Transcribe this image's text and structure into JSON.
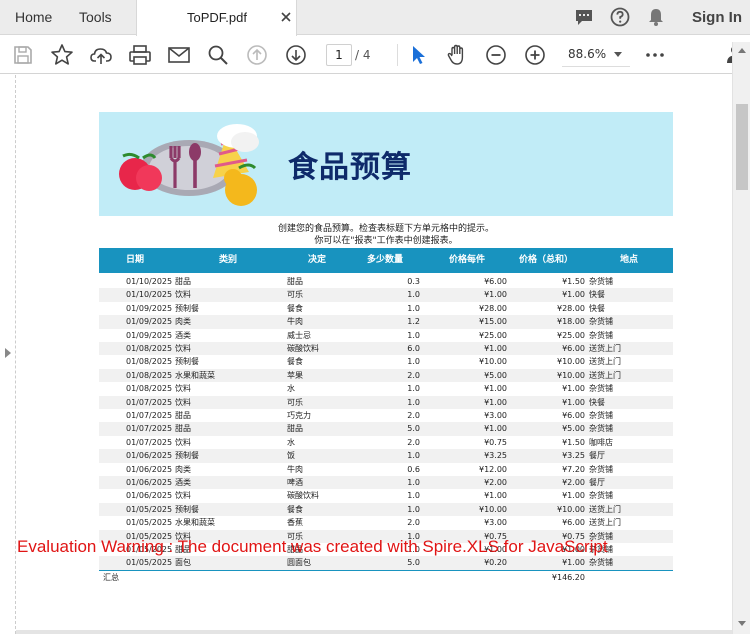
{
  "tabs": {
    "home": "Home",
    "tools": "Tools",
    "document": "ToPDF.pdf"
  },
  "header": {
    "sign_in": "Sign In"
  },
  "toolbar": {
    "current_page": "1",
    "total_pages": "/ 4",
    "zoom": "88.6%"
  },
  "document": {
    "title": "食品预算",
    "instruction_1": "创建您的食品预算。检查表标题下方单元格中的提示。",
    "instruction_2": "你可以在\"报表\"工作表中创建报表。",
    "columns": [
      "日期",
      "类别",
      "决定",
      "多少数量",
      "价格每件",
      "价格（总和）",
      "地点"
    ],
    "rows": [
      [
        "01/10/2025",
        "甜品",
        "甜品",
        "0.3",
        "¥6.00",
        "¥1.50",
        "杂货铺"
      ],
      [
        "01/10/2025",
        "饮料",
        "可乐",
        "1.0",
        "¥1.00",
        "¥1.00",
        "快餐"
      ],
      [
        "01/09/2025",
        "预制餐",
        "餐食",
        "1.0",
        "¥28.00",
        "¥28.00",
        "快餐"
      ],
      [
        "01/09/2025",
        "肉类",
        "牛肉",
        "1.2",
        "¥15.00",
        "¥18.00",
        "杂货铺"
      ],
      [
        "01/09/2025",
        "酒类",
        "威士忌",
        "1.0",
        "¥25.00",
        "¥25.00",
        "杂货铺"
      ],
      [
        "01/08/2025",
        "饮料",
        "碳酸饮料",
        "6.0",
        "¥1.00",
        "¥6.00",
        "送货上门"
      ],
      [
        "01/08/2025",
        "预制餐",
        "餐食",
        "1.0",
        "¥10.00",
        "¥10.00",
        "送货上门"
      ],
      [
        "01/08/2025",
        "水果和蔬菜",
        "苹果",
        "2.0",
        "¥5.00",
        "¥10.00",
        "送货上门"
      ],
      [
        "01/08/2025",
        "饮料",
        "水",
        "1.0",
        "¥1.00",
        "¥1.00",
        "杂货铺"
      ],
      [
        "01/07/2025",
        "饮料",
        "可乐",
        "1.0",
        "¥1.00",
        "¥1.00",
        "快餐"
      ],
      [
        "01/07/2025",
        "甜品",
        "巧克力",
        "2.0",
        "¥3.00",
        "¥6.00",
        "杂货铺"
      ],
      [
        "01/07/2025",
        "甜品",
        "甜品",
        "5.0",
        "¥1.00",
        "¥5.00",
        "杂货铺"
      ],
      [
        "01/07/2025",
        "饮料",
        "水",
        "2.0",
        "¥0.75",
        "¥1.50",
        "咖啡店"
      ],
      [
        "01/06/2025",
        "预制餐",
        "饭",
        "1.0",
        "¥3.25",
        "¥3.25",
        "餐厅"
      ],
      [
        "01/06/2025",
        "肉类",
        "牛肉",
        "0.6",
        "¥12.00",
        "¥7.20",
        "杂货铺"
      ],
      [
        "01/06/2025",
        "酒类",
        "啤酒",
        "1.0",
        "¥2.00",
        "¥2.00",
        "餐厅"
      ],
      [
        "01/06/2025",
        "饮料",
        "碳酸饮料",
        "1.0",
        "¥1.00",
        "¥1.00",
        "杂货铺"
      ],
      [
        "01/05/2025",
        "预制餐",
        "餐食",
        "1.0",
        "¥10.00",
        "¥10.00",
        "送货上门"
      ],
      [
        "01/05/2025",
        "水果和蔬菜",
        "香蕉",
        "2.0",
        "¥3.00",
        "¥6.00",
        "送货上门"
      ],
      [
        "01/05/2025",
        "饮料",
        "可乐",
        "1.0",
        "¥0.75",
        "¥0.75",
        "杂货铺"
      ],
      [
        "01/05/2025",
        "甜品",
        "甜品",
        "1.0",
        "¥1.00",
        "¥1.00",
        "杂货铺"
      ],
      [
        "01/05/2025",
        "面包",
        "圆面包",
        "5.0",
        "¥0.20",
        "¥1.00",
        "杂货铺"
      ]
    ],
    "total_label": "汇总",
    "total_value": "¥146.20",
    "watermark": "Evaluation Warning : The document was created with  Spire.XLS for JavaScript"
  },
  "icons": {
    "top": [
      "comment-icon",
      "help-icon",
      "bell-icon"
    ],
    "toolbar": [
      "save-icon",
      "star-icon",
      "cloud-upload-icon",
      "print-icon",
      "mail-icon",
      "search-icon",
      "page-up-icon",
      "page-down-icon",
      "select-arrow-icon",
      "hand-icon",
      "zoom-out-icon",
      "zoom-in-icon",
      "more-icon",
      "add-user-icon"
    ]
  },
  "colors": {
    "table_header": "#1893bf",
    "banner": "#c1ecf7",
    "title": "#0e2a6a",
    "watermark": "#e01414",
    "accent_cursor": "#1a6fd8"
  }
}
